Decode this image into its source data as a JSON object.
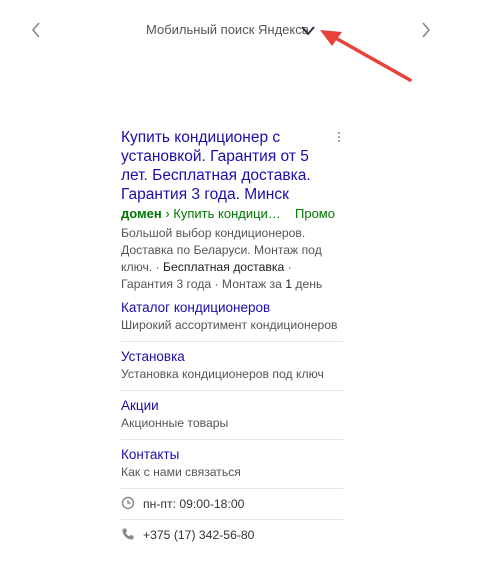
{
  "header": {
    "title": "Мобильный поиск Яндекса",
    "prev_icon": "chevron-left-icon",
    "next_icon": "chevron-right-icon",
    "dropdown_icon": "chevron-down-icon"
  },
  "annotation": {
    "color": "#e8413a"
  },
  "ad": {
    "title": "Купить кондиционер с установкой. Гарантия от 5 лет. Бесплатная доставка. Гарантия 3 года. Минск",
    "url_domain": "домен",
    "url_path": " › Купить кондици…",
    "promo": "Промо",
    "desc_1": "Большой выбор кондиционеров. Доставка по Беларуси. Монтаж под ключ. · ",
    "desc_hl_1": "Бесплатная доставка",
    "desc_2": " · Гарантия 3 года · Монтаж за ",
    "desc_hl_2": "1",
    "desc_3": " день"
  },
  "sitelinks": [
    {
      "title": "Каталог кондиционеров",
      "desc": "Широкий ассортимент кондиционеров"
    },
    {
      "title": "Установка",
      "desc": "Установка кондиционеров под ключ"
    },
    {
      "title": "Акции",
      "desc": "Акционные товары"
    },
    {
      "title": "Контакты",
      "desc": "Как с нами связаться"
    }
  ],
  "hours": {
    "icon": "clock-icon",
    "text": "пн-пт: 09:00-18:00"
  },
  "phone": {
    "icon": "phone-icon",
    "text": "+375 (17) 342-56-80"
  },
  "colors": {
    "link": "#1a0dab",
    "url": "#007700",
    "arrow": "#e8413a"
  }
}
